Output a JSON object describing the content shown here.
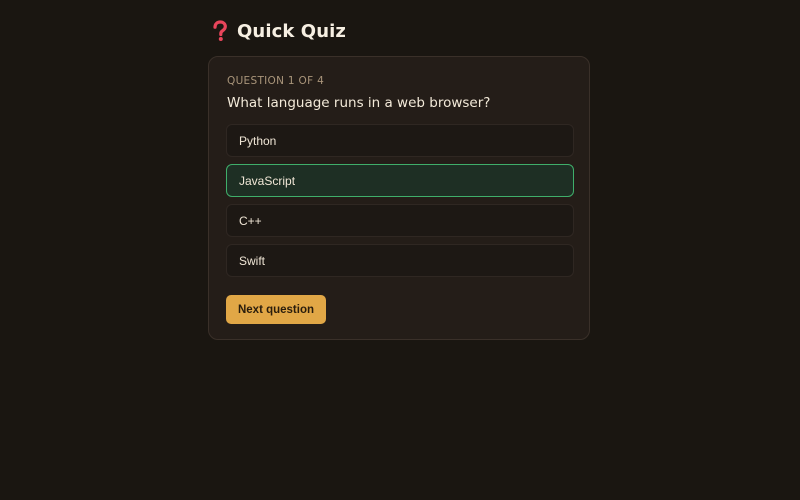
{
  "header": {
    "icon": "question-mark-icon",
    "title": "Quick Quiz"
  },
  "quiz": {
    "counter": "QUESTION 1 OF 4",
    "question": "What language runs in a web browser?",
    "options": [
      {
        "label": "Python",
        "selected": false
      },
      {
        "label": "JavaScript",
        "selected": true
      },
      {
        "label": "C++",
        "selected": false
      },
      {
        "label": "Swift",
        "selected": false
      }
    ],
    "next_label": "Next question"
  },
  "colors": {
    "background": "#1a1611",
    "card": "#241d18",
    "selected_border": "#3fae6a",
    "accent_button": "#e1a746",
    "icon_red": "#e8455b"
  }
}
